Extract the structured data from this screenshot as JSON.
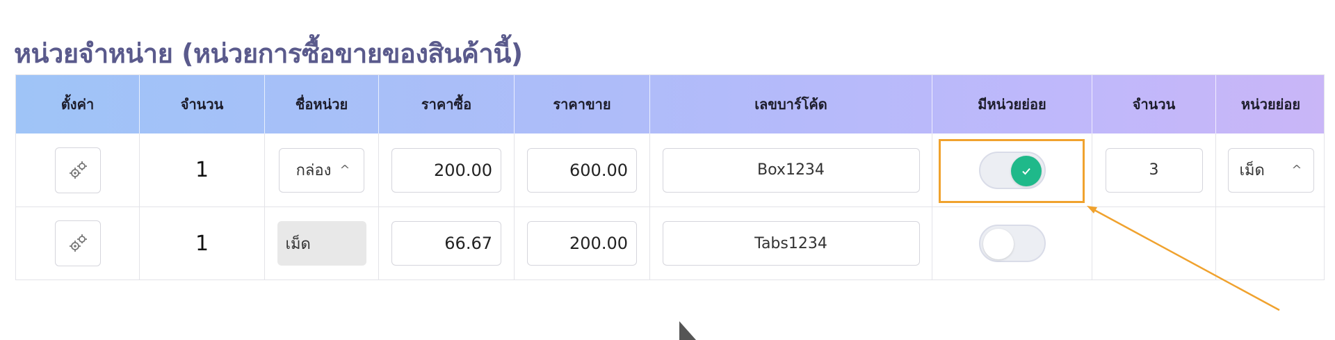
{
  "section": {
    "title": "หน่วยจำหน่าย (หน่วยการซื้อขายของสินค้านี้)"
  },
  "table": {
    "headers": [
      "ตั้งค่า",
      "จำนวน",
      "ชื่อหน่วย",
      "ราคาซื้อ",
      "ราคาขาย",
      "เลขบาร์โค้ด",
      "มีหน่วยย่อย",
      "จำนวน",
      "หน่วยย่อย"
    ],
    "rows": [
      {
        "qty": "1",
        "unit": "กล่อง",
        "buy_price": "200.00",
        "sell_price": "600.00",
        "barcode": "Box1234",
        "has_subunit": true,
        "sub_qty": "3",
        "sub_unit": "เม็ด"
      },
      {
        "qty": "1",
        "unit": "เม็ด",
        "buy_price": "66.67",
        "sell_price": "200.00",
        "barcode": "Tabs1234",
        "has_subunit": false
      }
    ]
  },
  "icons": {
    "settings": "gears-icon",
    "dropdown": "chevron-up-icon",
    "toggle_on": "check-icon",
    "annotation": "arrow-annotation",
    "pointer": "mouse-cursor-icon"
  },
  "colors": {
    "title": "#5a5a8c",
    "header_gradient_start": "#9fc4f7",
    "header_gradient_end": "#c9b6f7",
    "toggle_on": "#1fb98a",
    "highlight": "#f0a22e"
  }
}
